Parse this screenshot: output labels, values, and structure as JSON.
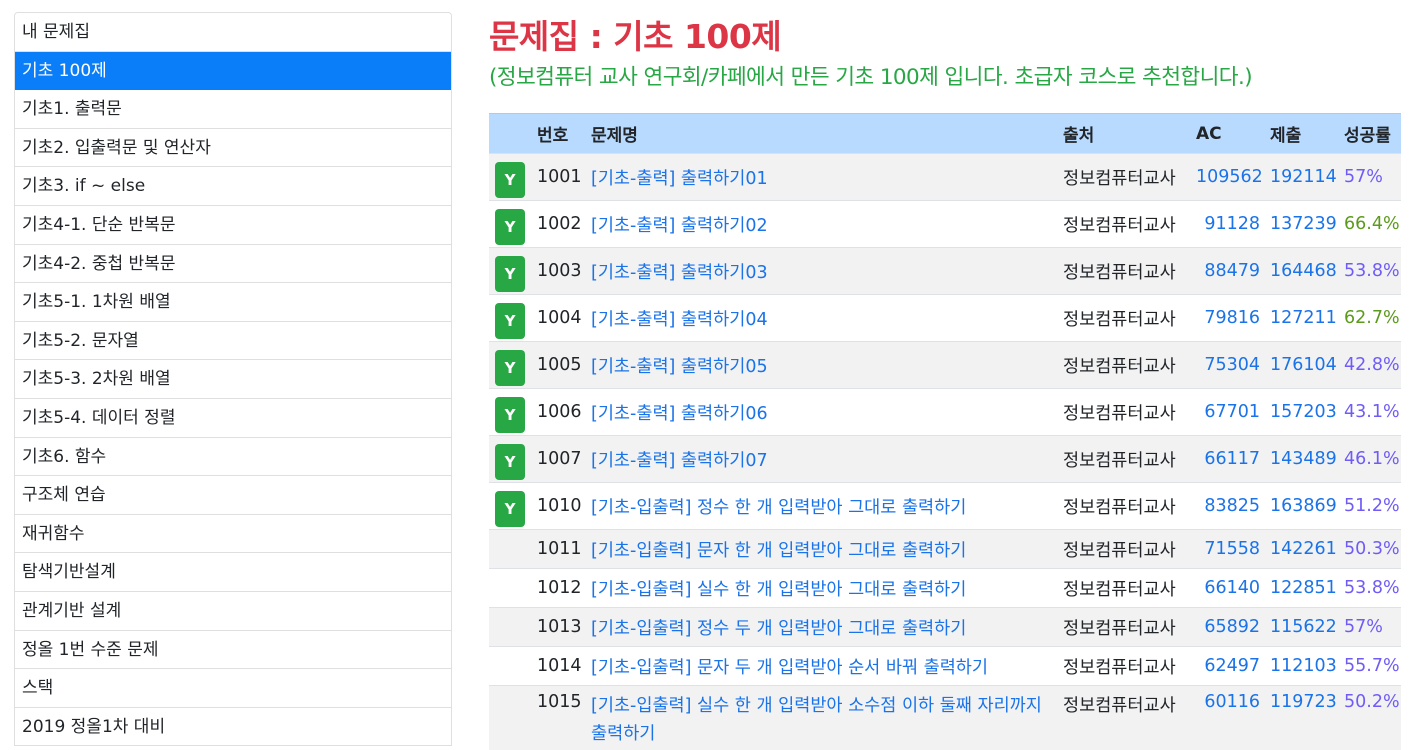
{
  "sidebar": {
    "items": [
      {
        "label": "내 문제집",
        "active": false
      },
      {
        "label": "기초 100제",
        "active": true
      },
      {
        "label": "기초1. 출력문",
        "active": false
      },
      {
        "label": "기초2. 입출력문 및 연산자",
        "active": false
      },
      {
        "label": "기초3. if ~ else",
        "active": false
      },
      {
        "label": "기초4-1. 단순 반복문",
        "active": false
      },
      {
        "label": "기초4-2. 중첩 반복문",
        "active": false
      },
      {
        "label": "기초5-1. 1차원 배열",
        "active": false
      },
      {
        "label": "기초5-2. 문자열",
        "active": false
      },
      {
        "label": "기초5-3. 2차원 배열",
        "active": false
      },
      {
        "label": "기초5-4. 데이터 정렬",
        "active": false
      },
      {
        "label": "기초6. 함수",
        "active": false
      },
      {
        "label": "구조체 연습",
        "active": false
      },
      {
        "label": "재귀함수",
        "active": false
      },
      {
        "label": "탐색기반설계",
        "active": false
      },
      {
        "label": "관계기반 설계",
        "active": false
      },
      {
        "label": "정올 1번 수준 문제",
        "active": false
      },
      {
        "label": "스택",
        "active": false
      },
      {
        "label": "2019 정올1차 대비",
        "active": false
      }
    ]
  },
  "main": {
    "title": "문제집 : 기초 100제",
    "subtitle": "(정보컴퓨터 교사 연구회/카페에서 만든 기초 100제 입니다. 초급자 코스로 추천합니다.)"
  },
  "table": {
    "headers": {
      "id": "번호",
      "title": "문제명",
      "source": "출처",
      "ac": "AC",
      "submit": "제출",
      "rate": "성공률"
    },
    "badge_label": "Y",
    "rows": [
      {
        "solved": true,
        "id": "1001",
        "title": "[기초-출력] 출력하기01",
        "source": "정보컴퓨터교사",
        "ac": "109562",
        "submit": "192114",
        "rate": "57%",
        "rate_color": "purple"
      },
      {
        "solved": true,
        "id": "1002",
        "title": "[기초-출력] 출력하기02",
        "source": "정보컴퓨터교사",
        "ac": "91128",
        "submit": "137239",
        "rate": "66.4%",
        "rate_color": "green"
      },
      {
        "solved": true,
        "id": "1003",
        "title": "[기초-출력] 출력하기03",
        "source": "정보컴퓨터교사",
        "ac": "88479",
        "submit": "164468",
        "rate": "53.8%",
        "rate_color": "purple"
      },
      {
        "solved": true,
        "id": "1004",
        "title": "[기초-출력] 출력하기04",
        "source": "정보컴퓨터교사",
        "ac": "79816",
        "submit": "127211",
        "rate": "62.7%",
        "rate_color": "green"
      },
      {
        "solved": true,
        "id": "1005",
        "title": "[기초-출력] 출력하기05",
        "source": "정보컴퓨터교사",
        "ac": "75304",
        "submit": "176104",
        "rate": "42.8%",
        "rate_color": "purple"
      },
      {
        "solved": true,
        "id": "1006",
        "title": "[기초-출력] 출력하기06",
        "source": "정보컴퓨터교사",
        "ac": "67701",
        "submit": "157203",
        "rate": "43.1%",
        "rate_color": "purple"
      },
      {
        "solved": true,
        "id": "1007",
        "title": "[기초-출력] 출력하기07",
        "source": "정보컴퓨터교사",
        "ac": "66117",
        "submit": "143489",
        "rate": "46.1%",
        "rate_color": "purple"
      },
      {
        "solved": true,
        "id": "1010",
        "title": "[기초-입출력] 정수 한 개 입력받아 그대로 출력하기",
        "source": "정보컴퓨터교사",
        "ac": "83825",
        "submit": "163869",
        "rate": "51.2%",
        "rate_color": "purple"
      },
      {
        "solved": false,
        "id": "1011",
        "title": "[기초-입출력] 문자 한 개 입력받아 그대로 출력하기",
        "source": "정보컴퓨터교사",
        "ac": "71558",
        "submit": "142261",
        "rate": "50.3%",
        "rate_color": "purple"
      },
      {
        "solved": false,
        "id": "1012",
        "title": "[기초-입출력] 실수 한 개 입력받아 그대로 출력하기",
        "source": "정보컴퓨터교사",
        "ac": "66140",
        "submit": "122851",
        "rate": "53.8%",
        "rate_color": "purple"
      },
      {
        "solved": false,
        "id": "1013",
        "title": "[기초-입출력] 정수 두 개 입력받아 그대로 출력하기",
        "source": "정보컴퓨터교사",
        "ac": "65892",
        "submit": "115622",
        "rate": "57%",
        "rate_color": "purple"
      },
      {
        "solved": false,
        "id": "1014",
        "title": "[기초-입출력] 문자 두 개 입력받아 순서 바꿔 출력하기",
        "source": "정보컴퓨터교사",
        "ac": "62497",
        "submit": "112103",
        "rate": "55.7%",
        "rate_color": "purple"
      },
      {
        "solved": false,
        "id": "1015",
        "title": "[기초-입출력] 실수 한 개 입력받아 소수점 이하 둘째 자리까지 출력하기",
        "source": "정보컴퓨터교사",
        "ac": "60116",
        "submit": "119723",
        "rate": "50.2%",
        "rate_color": "purple"
      }
    ]
  }
}
